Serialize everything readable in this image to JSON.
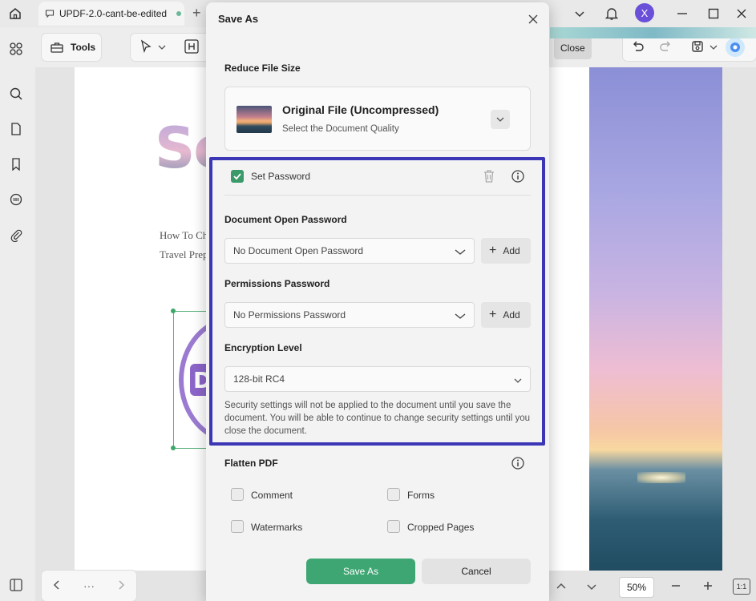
{
  "titlebar": {
    "tab_title": "UPDF-2.0-cant-be-edited",
    "new_tab_glyph": "+",
    "avatar_letter": "X"
  },
  "toolbar": {
    "tools_label": "Tools",
    "close_label": "Close"
  },
  "document": {
    "title_fragment": "Sea",
    "line1": "How To Choose Th",
    "line2": "Travel Preparatio",
    "stamp_text": "DRA"
  },
  "bottombar": {
    "zoom": "50%",
    "more": "···",
    "fit_label": "1:1"
  },
  "dialog": {
    "title": "Save As",
    "reduce_label": "Reduce File Size",
    "quality_title": "Original File (Uncompressed)",
    "quality_subtitle": "Select the Document Quality",
    "set_password_label": "Set Password",
    "open_password_label": "Document Open Password",
    "open_password_value": "No Document Open Password",
    "permissions_label": "Permissions Password",
    "permissions_value": "No Permissions Password",
    "add_label": "Add",
    "encryption_label": "Encryption Level",
    "encryption_value": "128-bit RC4",
    "note": "Security settings will not be applied to the document until you save the document. You will be able to continue to change security settings until you close the document.",
    "flatten_label": "Flatten PDF",
    "flatten_options": {
      "comment": "Comment",
      "forms": "Forms",
      "watermarks": "Watermarks",
      "cropped": "Cropped Pages"
    },
    "save_label": "Save As",
    "cancel_label": "Cancel"
  },
  "colors": {
    "accent_green": "#3ea673",
    "highlight_border": "#3a36b5",
    "avatar_purple": "#6a4fd8"
  }
}
